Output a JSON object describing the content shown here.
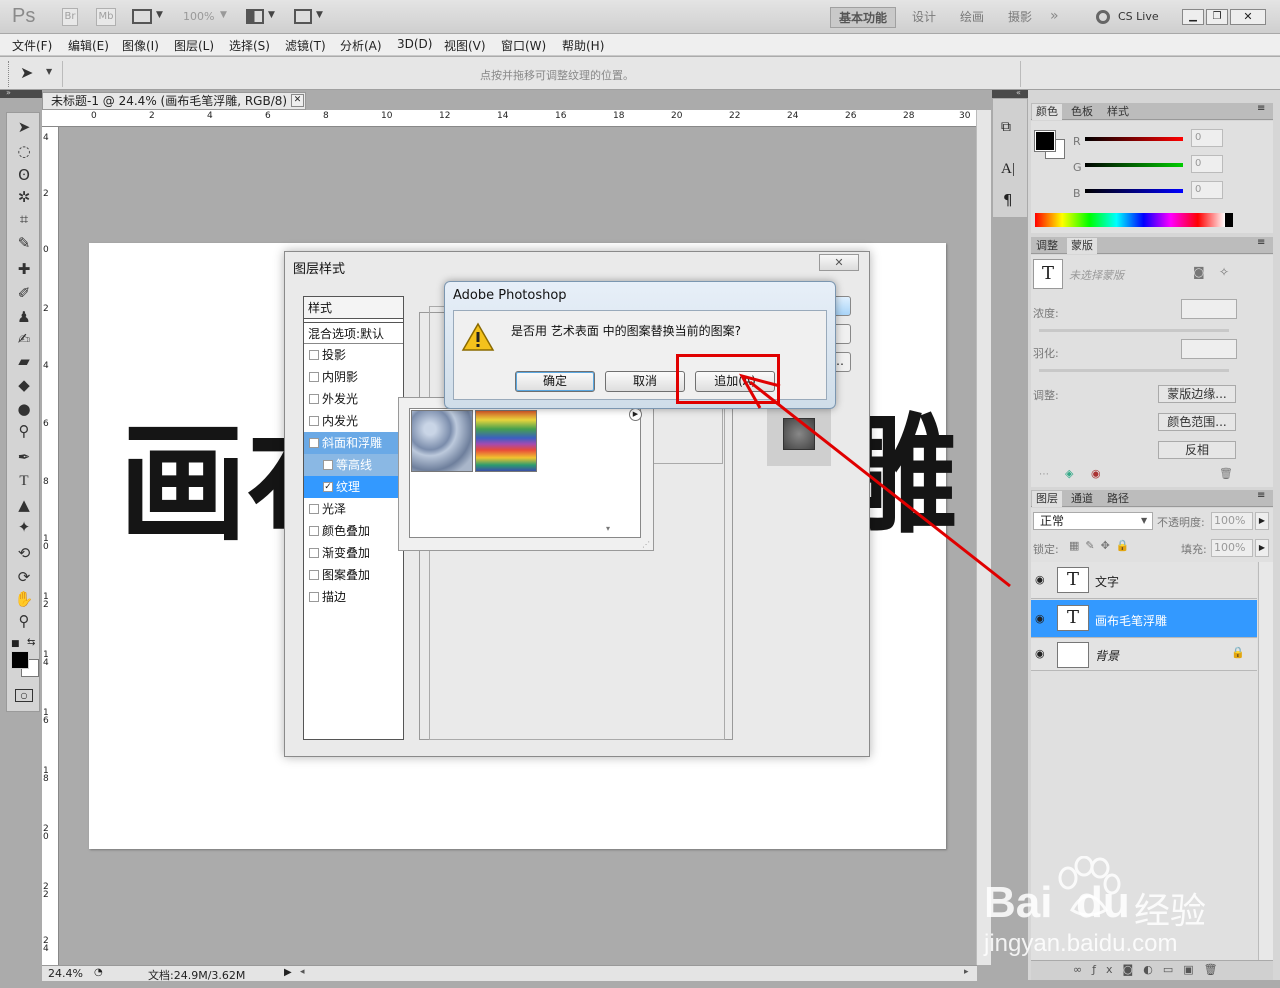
{
  "app": {
    "logo": "Ps",
    "bridge": "Br",
    "minibridge": "Mb",
    "zoom": "100%"
  },
  "workspaces": [
    "基本功能",
    "设计",
    "绘画",
    "摄影"
  ],
  "cslive": "CS Live",
  "menu": [
    "文件(F)",
    "编辑(E)",
    "图像(I)",
    "图层(L)",
    "选择(S)",
    "滤镜(T)",
    "分析(A)",
    "3D(D)",
    "视图(V)",
    "窗口(W)",
    "帮助(H)"
  ],
  "options_hint": "点按并拖移可调整纹理的位置。",
  "document": {
    "tab_title": "未标题-1 @ 24.4% (画布毛笔浮雕, RGB/8) *",
    "zoom": "24.4%",
    "doc_size": "文档:24.9M/3.62M"
  },
  "ruler_h": [
    "0",
    "2",
    "4",
    "6",
    "8",
    "10",
    "12",
    "14",
    "16",
    "18",
    "20",
    "22",
    "24",
    "26",
    "28",
    "30"
  ],
  "ruler_v": [
    "4",
    "2",
    "0",
    "2",
    "4",
    "6",
    "8",
    "1\n0",
    "1\n2",
    "1\n4",
    "1\n6",
    "1\n8",
    "2\n0",
    "2\n2",
    "2\n4"
  ],
  "canvas_text": {
    "left": "画布",
    "right": "雕"
  },
  "layer_style_dialog": {
    "title": "图层样式",
    "styles_header": "样式",
    "blend_options": "混合选项:默认",
    "styles": [
      {
        "label": "投影",
        "checked": false
      },
      {
        "label": "内阴影",
        "checked": false
      },
      {
        "label": "外发光",
        "checked": false
      },
      {
        "label": "内发光",
        "checked": false
      },
      {
        "label": "斜面和浮雕",
        "checked": true
      },
      {
        "label": "等高线",
        "checked": false
      },
      {
        "label": "纹理",
        "checked": true
      },
      {
        "label": "光泽",
        "checked": false
      },
      {
        "label": "颜色叠加",
        "checked": false
      },
      {
        "label": "渐变叠加",
        "checked": false
      },
      {
        "label": "图案叠加",
        "checked": false
      },
      {
        "label": "描边",
        "checked": false
      }
    ]
  },
  "alert": {
    "title": "Adobe Photoshop",
    "message": "是否用 艺术表面 中的图案替换当前的图案?",
    "ok": "确定",
    "cancel": "取消",
    "append": "追加(A)"
  },
  "color_panel": {
    "tabs": [
      "颜色",
      "色板",
      "样式"
    ],
    "r": "0",
    "g": "0",
    "b": "0",
    "r_label": "R",
    "g_label": "G",
    "b_label": "B"
  },
  "adjust_panel": {
    "tabs": [
      "调整",
      "蒙版"
    ],
    "no_mask": "未选择蒙版",
    "density": "浓度:",
    "feather": "羽化:",
    "refine": "调整:",
    "mask_edge": "蒙版边缘...",
    "color_range": "颜色范围...",
    "invert": "反相"
  },
  "layers_panel": {
    "tabs": [
      "图层",
      "通道",
      "路径"
    ],
    "blend_mode": "正常",
    "opacity_label": "不透明度:",
    "opacity": "100%",
    "lock_label": "锁定:",
    "fill_label": "填充:",
    "fill": "100%",
    "layers": [
      {
        "name": "文字",
        "thumb": "T",
        "selected": false
      },
      {
        "name": "画布毛笔浮雕",
        "thumb": "T",
        "selected": true
      },
      {
        "name": "背景",
        "thumb": "",
        "selected": false
      }
    ]
  },
  "watermark": {
    "logo": "Bai",
    "logo2": "du",
    "brand": "经验",
    "url": "jingyan.baidu.com"
  }
}
